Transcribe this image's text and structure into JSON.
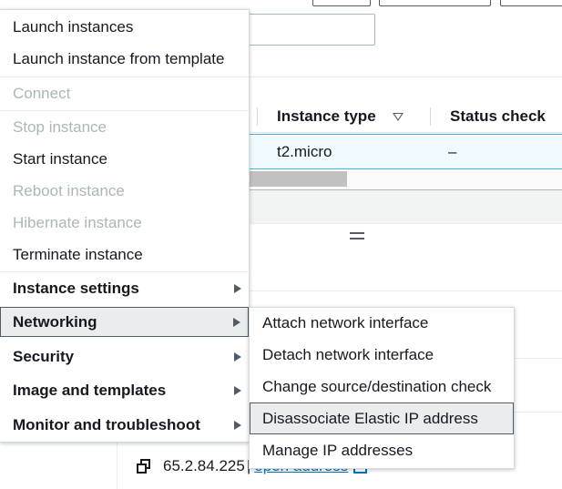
{
  "background": {
    "table": {
      "columns": [
        "Instance type",
        "Status check"
      ],
      "selected_row": {
        "instance_type": "t2.micro",
        "status_check": "–"
      }
    },
    "public_ip": {
      "address": "65.2.84.225",
      "separator": "|",
      "link_label": "open address"
    }
  },
  "actions_menu": {
    "items": [
      {
        "label": "Launch instances"
      },
      {
        "label": "Launch instance from template"
      },
      {
        "label": "Connect",
        "disabled": true
      },
      {
        "label": "Stop instance",
        "disabled": true
      },
      {
        "label": "Start instance"
      },
      {
        "label": "Reboot instance",
        "disabled": true
      },
      {
        "label": "Hibernate instance",
        "disabled": true
      },
      {
        "label": "Terminate instance"
      },
      {
        "label": "Instance settings",
        "has_submenu": true
      },
      {
        "label": "Networking",
        "has_submenu": true,
        "active": true
      },
      {
        "label": "Security",
        "has_submenu": true
      },
      {
        "label": "Image and templates",
        "has_submenu": true
      },
      {
        "label": "Monitor and troubleshoot",
        "has_submenu": true
      }
    ]
  },
  "networking_submenu": {
    "items": [
      {
        "label": "Attach network interface"
      },
      {
        "label": "Detach network interface"
      },
      {
        "label": "Change source/destination check"
      },
      {
        "label": "Disassociate Elastic IP address",
        "active": true
      },
      {
        "label": "Manage IP addresses"
      }
    ]
  },
  "colors": {
    "link": "#0073bb",
    "selected_row_bg": "#f1faff",
    "selected_row_border": "#44b9d6",
    "disabled_text": "#aab7b8",
    "hover_bg": "#eaeded"
  },
  "icons": [
    "filter-icon",
    "copy-icon",
    "external-link-icon",
    "chevron-right-icon",
    "drag-handle-icon"
  ]
}
